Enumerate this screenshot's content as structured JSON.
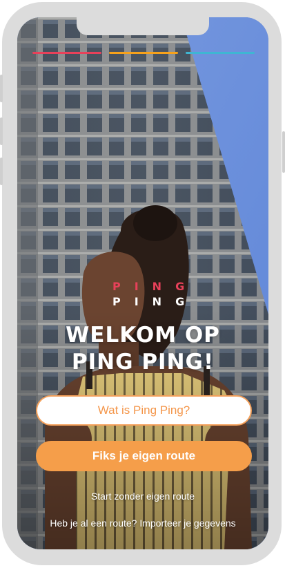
{
  "colors": {
    "accent_orange": "#f59e4a",
    "stripe_red": "#e8415a",
    "stripe_orange": "#f7a21b",
    "stripe_blue": "#3fb6d3",
    "sky": "#6f8fce"
  },
  "logo": {
    "line1": "PING",
    "line2": "PING"
  },
  "welcome": {
    "title_line1": "WELKOM OP",
    "title_line2": "PING PING!"
  },
  "buttons": {
    "what_is": "Wat is Ping Ping?",
    "fix_route": "Fiks je eigen route"
  },
  "links": {
    "start_without": "Start zonder eigen route",
    "import": "Heb je al een route? Importeer je gegevens"
  },
  "background": {
    "image": "woman-in-front-of-building-photo"
  }
}
